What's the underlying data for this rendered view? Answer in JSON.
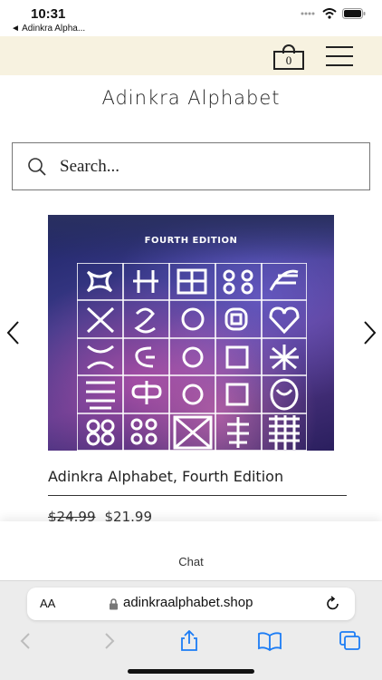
{
  "status": {
    "time": "10:31",
    "back_app": "◄ Adinkra Alpha..."
  },
  "header": {
    "cart_count": "0"
  },
  "brand": {
    "name": "Adinkra Alphabet"
  },
  "search": {
    "placeholder": "Search..."
  },
  "product": {
    "image_caption": "FOURTH EDITION",
    "title": "Adinkra Alphabet, Fourth Edition",
    "old_price": "$24.99",
    "price": "$21.99"
  },
  "chat": {
    "label": "Chat"
  },
  "browser": {
    "aa": "AA",
    "url": "adinkraalphabet.shop"
  },
  "colors": {
    "header_bg": "#f7f2e0",
    "ios_blue": "#1b7cf5"
  }
}
